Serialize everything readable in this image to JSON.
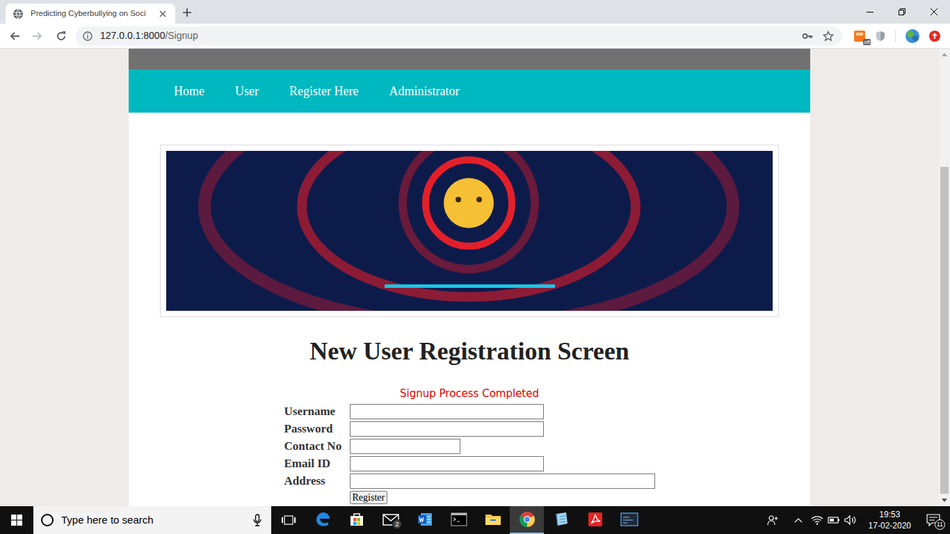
{
  "tabs": [
    {
      "label": "Predicting Cyberbullying on Soci",
      "selected": true
    }
  ],
  "address_bar": {
    "host": "127.0.0.1:8000",
    "path": "/Signup"
  },
  "extension_badge": "off",
  "nav": {
    "items": [
      "Home",
      "User",
      "Register Here",
      "Administrator"
    ]
  },
  "heading": "New User Registration Screen",
  "message": "Signup Process Completed",
  "form": {
    "fields": [
      {
        "label": "Username",
        "value": "",
        "kind": "normal"
      },
      {
        "label": "Password",
        "value": "",
        "kind": "normal"
      },
      {
        "label": "Contact No",
        "value": "",
        "kind": "short"
      },
      {
        "label": "Email ID",
        "value": "",
        "kind": "normal"
      },
      {
        "label": "Address",
        "value": "",
        "kind": "wide"
      }
    ],
    "submit": "Register"
  },
  "taskbar": {
    "search": {
      "placeholder": "Type here to search"
    },
    "apps": [
      {
        "selected": false
      },
      {
        "selected": false
      },
      {
        "selected": false,
        "badge": "2"
      },
      {
        "selected": false
      },
      {
        "selected": false
      },
      {
        "selected": false
      },
      {
        "selected": true
      },
      {
        "selected": false
      },
      {
        "selected": false
      },
      {
        "selected": false
      }
    ],
    "time": "19:53",
    "date": "17-02-2020",
    "notifications": "11"
  }
}
